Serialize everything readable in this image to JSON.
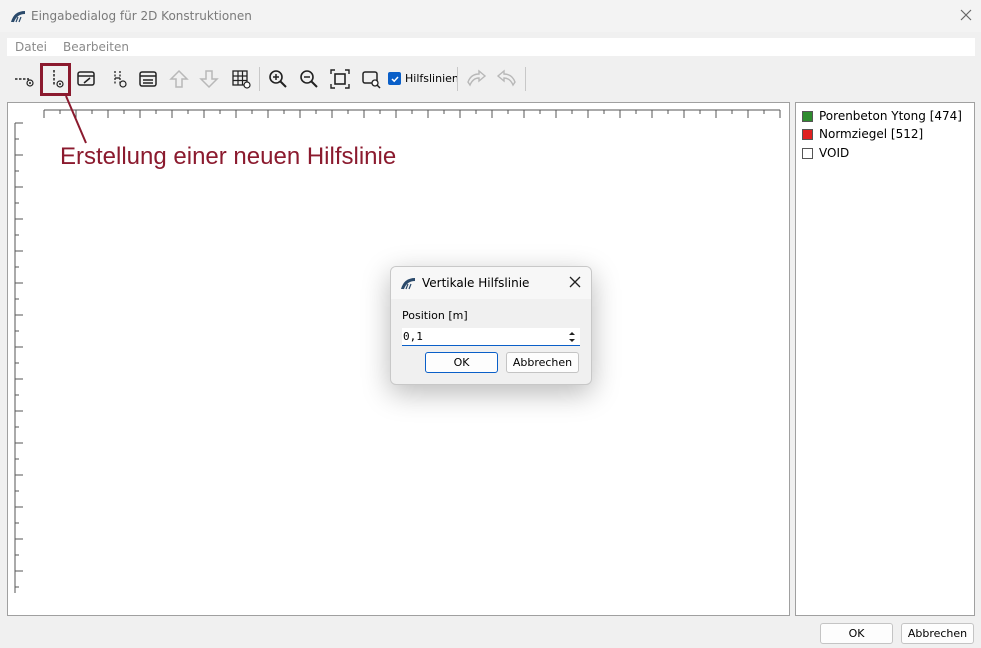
{
  "window": {
    "title": "Eingabedialog für 2D Konstruktionen"
  },
  "menu": {
    "file": "Datei",
    "edit": "Bearbeiten"
  },
  "toolbar": {
    "guides_checkbox_label": "Hilfslinien",
    "guides_checked": true
  },
  "annotation": {
    "text": "Erstellung einer neuen Hilfslinie",
    "color": "#8b1a2e"
  },
  "legend": {
    "items": [
      {
        "label": "Porenbeton Ytong [474]",
        "color": "#2e8b2e"
      },
      {
        "label": "Normziegel [512]",
        "color": "#e02020"
      },
      {
        "label": "VOID",
        "color": "#ffffff"
      }
    ]
  },
  "dialog": {
    "title": "Vertikale Hilfslinie",
    "field_label": "Position [m]",
    "field_value": "0,1",
    "ok": "OK",
    "cancel": "Abbrechen"
  },
  "footer": {
    "ok": "OK",
    "cancel": "Abbrechen"
  },
  "colors": {
    "accent": "#0a5fc8"
  }
}
